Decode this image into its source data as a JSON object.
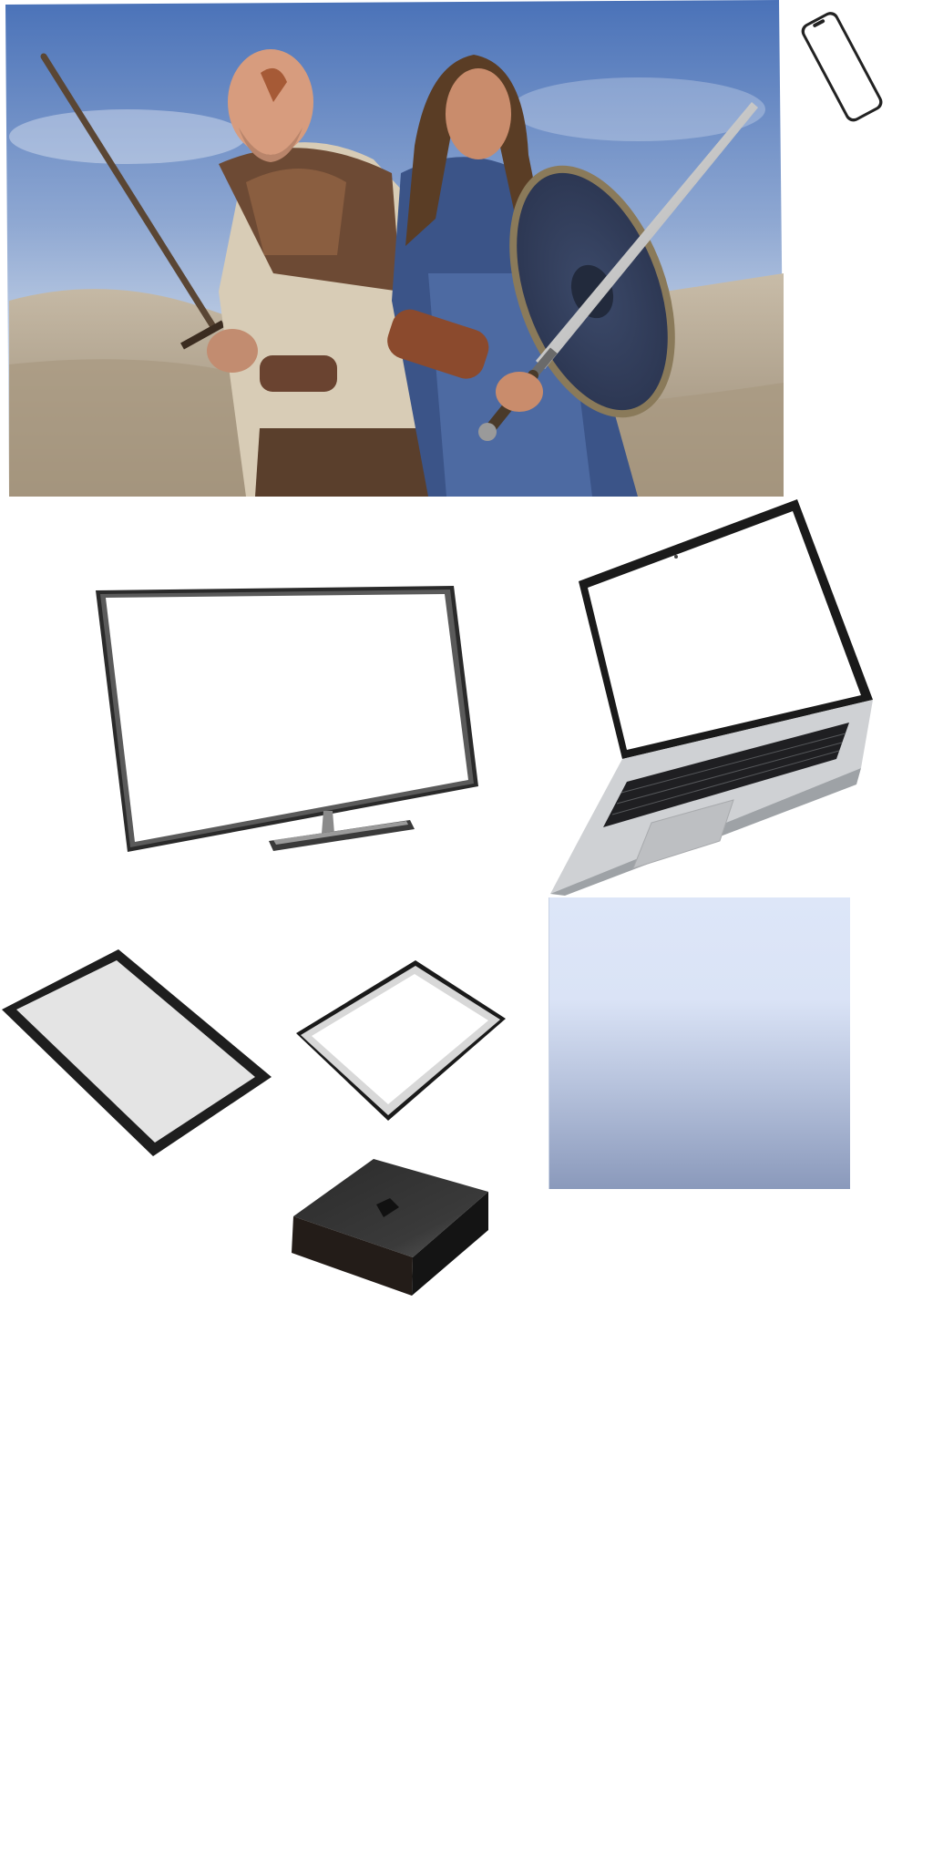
{
  "page": {
    "background": "#ffffff"
  },
  "hero_image": {
    "description_icon": "two-warriors-with-swords-photo",
    "sky_top": "#4a72b8",
    "sky_bottom": "#cdd9ea",
    "sand": "#b5a690"
  },
  "devices": [
    {
      "name": "smartphone",
      "icon": "smartphone-icon"
    },
    {
      "name": "monitor",
      "icon": "monitor-icon"
    },
    {
      "name": "laptop",
      "icon": "laptop-icon"
    },
    {
      "name": "tablet-large",
      "icon": "tablet-icon"
    },
    {
      "name": "tablet-small",
      "icon": "tablet-icon"
    },
    {
      "name": "media-box",
      "icon": "media-box-icon"
    }
  ],
  "gradient_panel": {
    "top_color": "#dde6f8",
    "bottom_color": "#8a99bb"
  }
}
